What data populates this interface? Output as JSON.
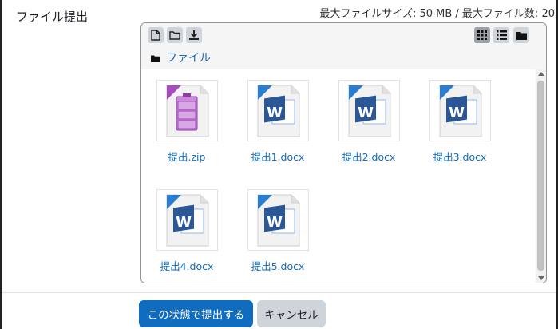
{
  "field": {
    "label": "ファイル提出"
  },
  "limits": {
    "text": "最大ファイルサイズ: 50 MB / 最大ファイル数: 20"
  },
  "toolbar": {
    "icons": [
      "add-file-icon",
      "create-folder-icon",
      "download-icon",
      "icon-view-icon",
      "list-view-icon",
      "tree-view-icon"
    ],
    "active_view": "icons"
  },
  "breadcrumb": {
    "label": "ファイル"
  },
  "files": [
    {
      "name": "提出.zip",
      "type": "zip"
    },
    {
      "name": "提出1.docx",
      "type": "docx"
    },
    {
      "name": "提出2.docx",
      "type": "docx"
    },
    {
      "name": "提出3.docx",
      "type": "docx"
    },
    {
      "name": "提出4.docx",
      "type": "docx"
    },
    {
      "name": "提出5.docx",
      "type": "docx"
    }
  ],
  "actions": {
    "submit": "この状態で提出する",
    "cancel": "キャンセル"
  },
  "colors": {
    "primary": "#0f6cbf",
    "secondary": "#ced4da",
    "zip_accent": "#a84dbf",
    "word_accent": "#2b7cd3"
  }
}
